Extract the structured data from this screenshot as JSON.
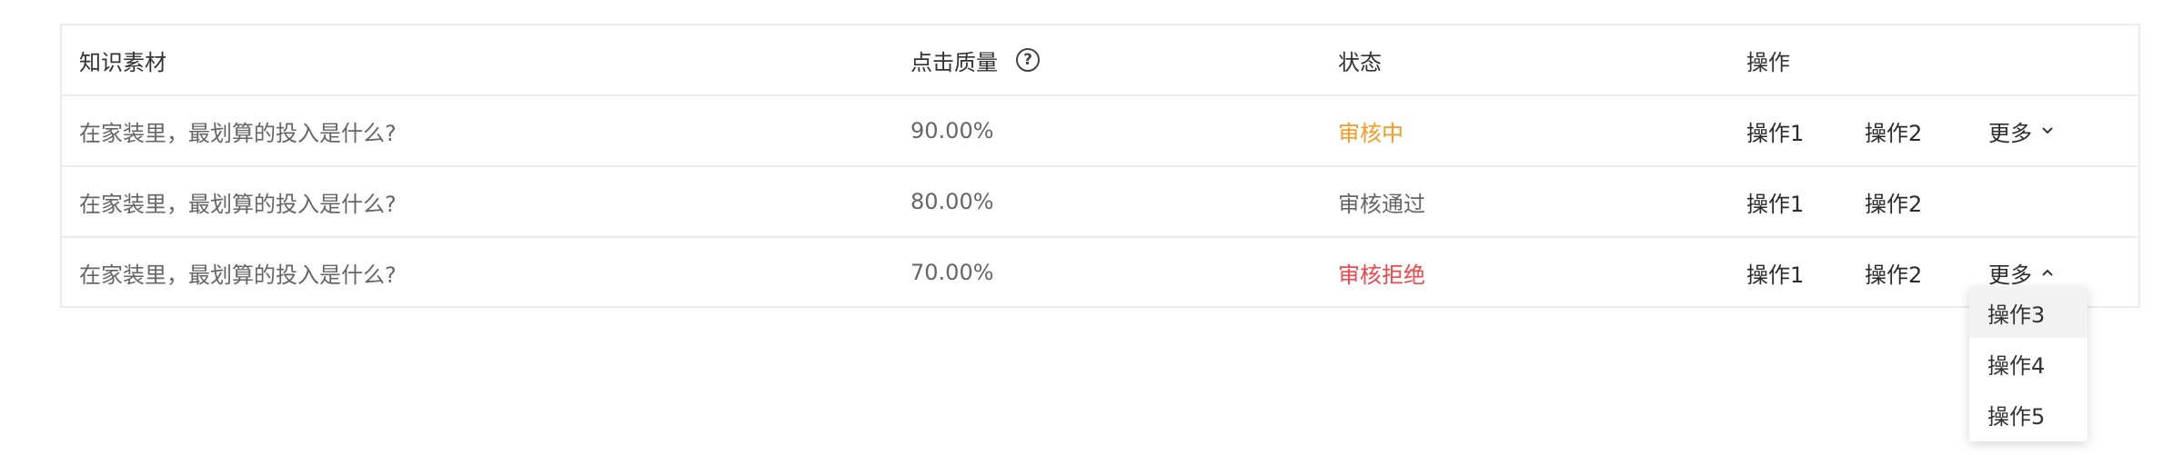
{
  "table": {
    "headers": {
      "material": "知识素材",
      "quality": "点击质量",
      "status": "状态",
      "ops": "操作"
    },
    "rows": [
      {
        "material": "在家装里，最划算的投入是什么?",
        "quality": "90.00%",
        "status": "审核中",
        "op1": "操作1",
        "op2": "操作2",
        "more": "更多"
      },
      {
        "material": "在家装里，最划算的投入是什么?",
        "quality": "80.00%",
        "status": "审核通过",
        "op1": "操作1",
        "op2": "操作2"
      },
      {
        "material": "在家装里，最划算的投入是什么?",
        "quality": "70.00%",
        "status": "审核拒绝",
        "op1": "操作1",
        "op2": "操作2",
        "more": "更多"
      }
    ]
  },
  "dropdown": {
    "items": [
      "操作3",
      "操作4",
      "操作5"
    ]
  },
  "colors": {
    "status_pending": "#f59a23",
    "status_approved": "#666666",
    "status_rejected": "#f2464b"
  },
  "icons": {
    "help": "question-circle-icon",
    "more_closed": "chevron-down-icon",
    "more_open": "chevron-up-icon"
  }
}
